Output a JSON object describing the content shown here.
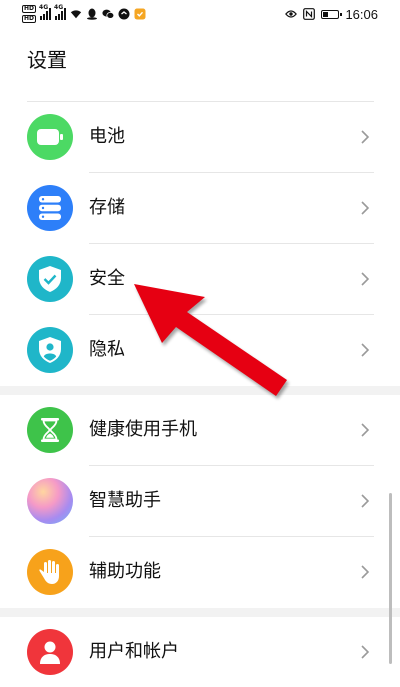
{
  "status_bar": {
    "hd_top": "HD",
    "hd_bottom": "HD",
    "sig1_label": "4G",
    "sig2_label": "4G",
    "time": "16:06",
    "battery_level": 0.35
  },
  "page": {
    "title": "设置"
  },
  "settings": [
    {
      "label": "电池",
      "icon": "battery-icon",
      "color": "#4cd964"
    },
    {
      "label": "存储",
      "icon": "storage-icon",
      "color": "#2d7ff9"
    },
    {
      "label": "安全",
      "icon": "shield-check-icon",
      "color": "#1fb6c9"
    },
    {
      "label": "隐私",
      "icon": "privacy-shield-icon",
      "color": "#1fb6c9"
    },
    {
      "label": "健康使用手机",
      "icon": "hourglass-icon",
      "color": "#3ec34a"
    },
    {
      "label": "智慧助手",
      "icon": "assistant-orb-icon",
      "color": "#c79bf2"
    },
    {
      "label": "辅助功能",
      "icon": "hand-icon",
      "color": "#f7a21b"
    },
    {
      "label": "用户和帐户",
      "icon": "user-icon",
      "color": "#f0353b"
    }
  ],
  "colors": {
    "annotation_arrow": "#e60012"
  }
}
